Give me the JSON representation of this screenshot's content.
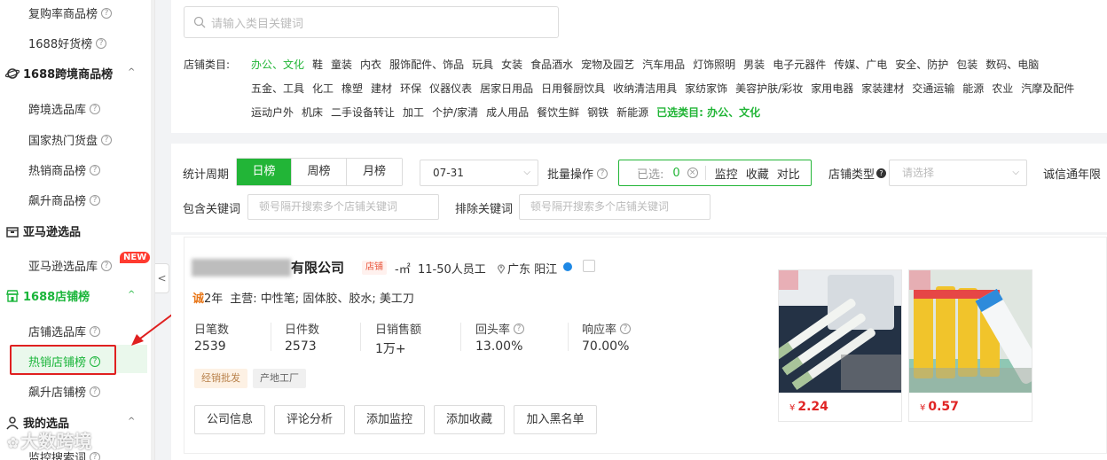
{
  "sidebar": {
    "items": {
      "repurchase": "复购率商品榜",
      "good_goods": "1688好货榜",
      "cross_border_group": "1688跨境商品榜",
      "cross_border_lib": "跨境选品库",
      "national_hot": "国家热门货盘",
      "hot_products": "热销商品榜",
      "rising_products": "飙升商品榜",
      "amazon_group": "亚马逊选品",
      "amazon_lib": "亚马逊选品库",
      "amazon_new_badge": "NEW",
      "shop_group": "1688店铺榜",
      "shop_lib": "店铺选品库",
      "hot_shops": "热销店铺榜",
      "rising_shops": "飙升店铺榜",
      "my_group": "我的选品",
      "monitor_keywords": "监控搜索词"
    },
    "help_glyph": "?",
    "chevron_up": "^",
    "collapse_glyph": "<"
  },
  "search": {
    "placeholder": "请输入类目关键词"
  },
  "categories": {
    "label": "店铺类目:",
    "row1": [
      "办公、文化",
      "鞋",
      "童装",
      "内衣",
      "服饰配件、饰品",
      "玩具",
      "女装",
      "食品酒水",
      "宠物及园艺",
      "汽车用品",
      "灯饰照明",
      "男装",
      "电子元器件",
      "传媒、广电",
      "安全、防护",
      "包装",
      "数码、电脑"
    ],
    "row2": [
      "五金、工具",
      "化工",
      "橡塑",
      "建材",
      "环保",
      "仪器仪表",
      "居家日用品",
      "日用餐厨饮具",
      "收纳清洁用具",
      "家纺家饰",
      "美容护肤/彩妆",
      "家用电器",
      "家装建材",
      "交通运输",
      "能源",
      "农业",
      "汽摩及配件"
    ],
    "row3": [
      "运动户外",
      "机床",
      "二手设备转让",
      "加工",
      "个护/家清",
      "成人用品",
      "餐饮生鲜",
      "钢铁",
      "新能源"
    ],
    "selected_label": "已选类目: 办公、文化"
  },
  "filters": {
    "period_label": "统计周期",
    "periods": [
      "日榜",
      "周榜",
      "月榜"
    ],
    "date_value": "07-31",
    "batch_label": "批量操作",
    "selected_text": "已选:",
    "selected_count": "0",
    "monitor": "监控",
    "favorite": "收藏",
    "compare": "对比",
    "shop_type_label": "店铺类型",
    "shop_type_placeholder": "请选择",
    "credit_label": "诚信通年限",
    "include_label": "包含关键词",
    "include_placeholder": "顿号隔开搜索多个店铺关键词",
    "exclude_label": "排除关键词",
    "exclude_placeholder": "顿号隔开搜索多个店铺关键词"
  },
  "shop": {
    "name_suffix": "有限公司",
    "tag_shop": "店铺",
    "area": "-㎡",
    "staff": "11-50人员工",
    "location": "广东 阳江",
    "years_badge": "诚",
    "years": "2年",
    "main_business": "主营: 中性笔; 固体胶、胶水; 美工刀",
    "stats": [
      {
        "label": "日笔数",
        "value": "2539"
      },
      {
        "label": "日件数",
        "value": "2573"
      },
      {
        "label": "日销售额",
        "value": "1万+"
      },
      {
        "label": "回头率",
        "value": "13.00%"
      },
      {
        "label": "响应率",
        "value": "70.00%"
      }
    ],
    "tags": [
      "经销批发",
      "产地工厂"
    ],
    "actions": [
      "公司信息",
      "评论分析",
      "添加监控",
      "添加收藏",
      "加入黑名单"
    ],
    "products": [
      {
        "currency": "¥",
        "price": "2.24"
      },
      {
        "currency": "¥",
        "price": "0.57"
      }
    ]
  },
  "watermark": "大数跨境",
  "colors": {
    "accent": "#22b537",
    "price": "#e02424",
    "new_badge": "#ff3b30",
    "highlight": "#e02020"
  }
}
